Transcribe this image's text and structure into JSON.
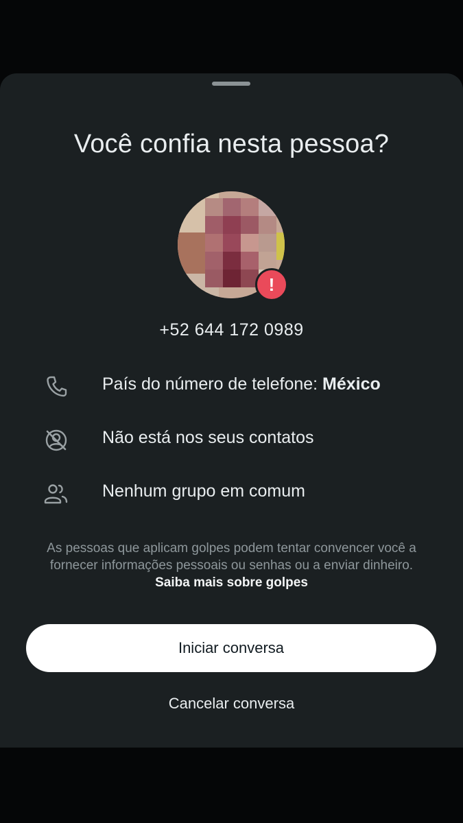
{
  "dialog": {
    "title": "Você confia nesta pessoa?",
    "phone_number": "+52 644 172 0989",
    "warning_badge_symbol": "!",
    "warning_badge_color": "#ea4a5a"
  },
  "info_rows": [
    {
      "icon": "phone-icon",
      "label": "País do número de telefone: ",
      "value": "México"
    },
    {
      "icon": "no-contact-icon",
      "label": "Não está nos seus contatos"
    },
    {
      "icon": "group-icon",
      "label": "Nenhum grupo em comum"
    }
  ],
  "warning": {
    "text": "As pessoas que aplicam golpes podem tentar convencer você a fornecer informações pessoais ou senhas ou a enviar dinheiro.",
    "link_label": "Saiba mais sobre golpes"
  },
  "actions": {
    "start_label": "Iniciar conversa",
    "cancel_label": "Cancelar conversa"
  },
  "colors": {
    "sheet_background": "#1b2022",
    "primary_button_background": "#ffffff"
  }
}
